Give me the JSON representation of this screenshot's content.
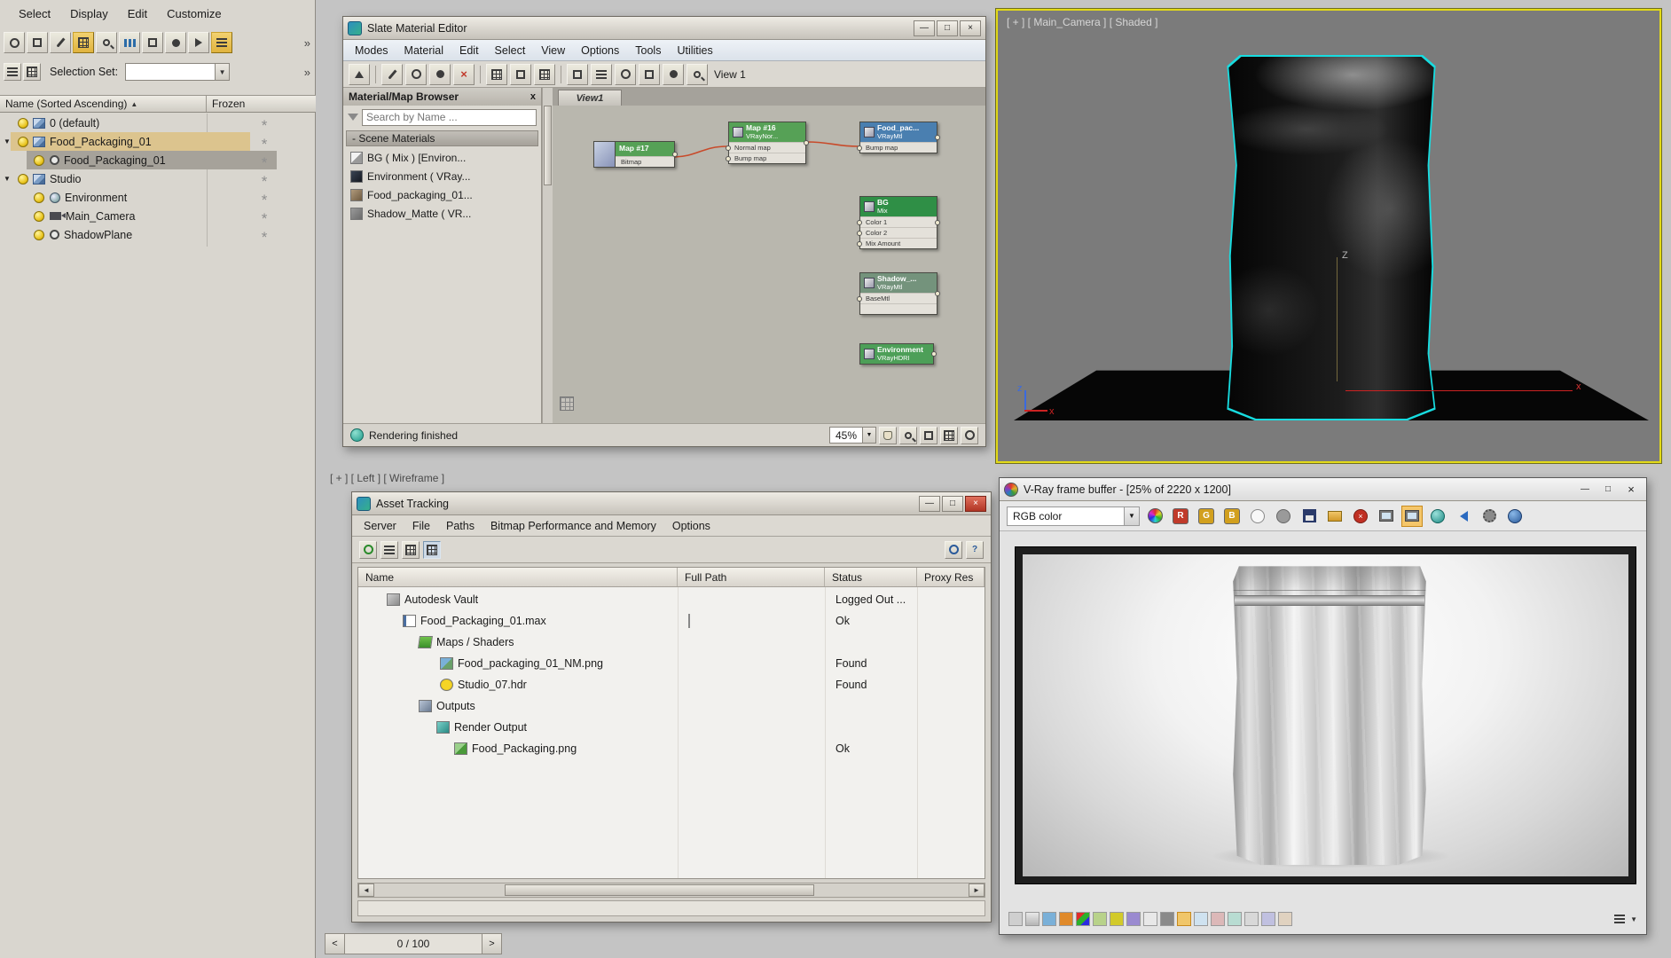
{
  "glyphs": {
    "down": "▼",
    "sort": "▲",
    "left": "◄",
    "right": "►",
    "overflow": "»",
    "min": "—",
    "max": "□",
    "close": "×",
    "frozen": "*",
    "help": "?",
    "tri_open": "▼"
  },
  "app": {
    "menus": [
      "Select",
      "Display",
      "Edit",
      "Customize"
    ],
    "selection_set_label": "Selection Set:"
  },
  "explorer": {
    "col_name": "Name (Sorted Ascending)",
    "col_frozen": "Frozen",
    "rows": [
      {
        "label": "0 (default)"
      },
      {
        "label": "Food_Packaging_01"
      },
      {
        "label": "Food_Packaging_01"
      },
      {
        "label": "Studio"
      },
      {
        "label": "Environment"
      },
      {
        "label": "Main_Camera"
      },
      {
        "label": "ShadowPlane"
      }
    ]
  },
  "slate": {
    "title": "Slate Material Editor",
    "menus": [
      "Modes",
      "Material",
      "Edit",
      "Select",
      "View",
      "Options",
      "Tools",
      "Utilities"
    ],
    "view_button_label": "View 1",
    "browser_title": "Material/Map Browser",
    "browser_close": "x",
    "search_placeholder": "Search by Name ...",
    "group_label": "- Scene Materials",
    "materials": [
      "BG ( Mix ) [Environ...",
      "Environment ( VRay...",
      "Food_packaging_01...",
      "Shadow_Matte ( VR..."
    ],
    "tab_label": "View1",
    "status": "Rendering finished",
    "zoom": "45%",
    "nodes": [
      {
        "title": "Map #17",
        "subtitle": "Bitmap",
        "color": "#56a156"
      },
      {
        "title": "Map #16",
        "subtitle": "VRayNor...",
        "color": "#56a156",
        "slots": [
          "Normal map",
          "Bump map"
        ]
      },
      {
        "title": "Food_pac...",
        "subtitle": "VRayMtl",
        "color": "#4a7fb0",
        "slots": [
          "Bump map"
        ]
      },
      {
        "title": "BG",
        "subtitle": "Mix",
        "color": "#2f8f46",
        "slots": [
          "Color 1",
          "Color 2",
          "Mix Amount"
        ]
      },
      {
        "title": "Shadow_...",
        "subtitle": "VRayMtl",
        "color": "#74937c",
        "slots": [
          "BaseMtl"
        ]
      },
      {
        "title": "Environment",
        "subtitle": "VRayHDRI",
        "color": "#4d9f58"
      }
    ]
  },
  "viewport": {
    "label": "[ + ] [ Main_Camera ] [ Shaded ]",
    "axis_x": "x",
    "axis_z": "z",
    "pivot": "Z"
  },
  "left_viewport": {
    "label": "[ + ] [ Left ] [ Wireframe ]"
  },
  "asset": {
    "title": "Asset Tracking",
    "menus": [
      "Server",
      "File",
      "Paths",
      "Bitmap Performance and Memory",
      "Options"
    ],
    "columns": [
      "Name",
      "Full Path",
      "Status",
      "Proxy Res"
    ],
    "rows": [
      {
        "name": "Autodesk Vault",
        "status": "Logged Out ..."
      },
      {
        "name": "Food_Packaging_01.max",
        "status": "Ok"
      },
      {
        "name": "Maps / Shaders",
        "status": ""
      },
      {
        "name": "Food_packaging_01_NM.png",
        "status": "Found"
      },
      {
        "name": "Studio_07.hdr",
        "status": "Found"
      },
      {
        "name": "Outputs",
        "status": ""
      },
      {
        "name": "Render Output",
        "status": ""
      },
      {
        "name": "Food_Packaging.png",
        "status": "Ok"
      }
    ]
  },
  "vfb": {
    "title": "V-Ray frame buffer - [25% of 2220 x 1200]",
    "channel": "RGB color",
    "r": "R",
    "g": "G",
    "b": "B"
  },
  "timeline": {
    "prev": "<",
    "next": ">",
    "value": "0 / 100"
  }
}
